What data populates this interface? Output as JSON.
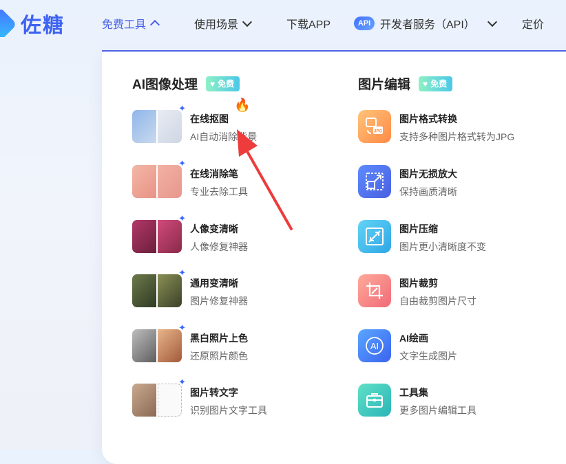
{
  "header": {
    "logo_text": "佐糖",
    "nav": [
      {
        "label": "免费工具",
        "state": "expanded"
      },
      {
        "label": "使用场景",
        "state": "collapsed"
      },
      {
        "label": "下载APP"
      },
      {
        "label": "开发者服务（API）",
        "badge": "API",
        "state": "collapsed"
      },
      {
        "label": "定价"
      }
    ],
    "accent_color": "#4a62e3"
  },
  "dropdown": {
    "sections": [
      {
        "title": "AI图像处理",
        "badge": "免费",
        "items": [
          {
            "title": "在线抠图",
            "desc": "AI自动消除背景",
            "hot_icon": "fire-icon"
          },
          {
            "title": "在线消除笔",
            "desc": "专业去除工具"
          },
          {
            "title": "人像变清晰",
            "desc": "人像修复神器"
          },
          {
            "title": "通用变清晰",
            "desc": "图片修复神器"
          },
          {
            "title": "黑白照片上色",
            "desc": "还原照片颜色"
          },
          {
            "title": "图片转文字",
            "desc": "识别图片文字工具"
          }
        ]
      },
      {
        "title": "图片编辑",
        "badge": "免费",
        "items": [
          {
            "title": "图片格式转换",
            "desc": "支持多种图片格式转为JPG",
            "icon": "format-convert-icon",
            "icon_label": "JPG"
          },
          {
            "title": "图片无损放大",
            "desc": "保持画质清晰",
            "icon": "upscale-icon"
          },
          {
            "title": "图片压缩",
            "desc": "图片更小清晰度不变",
            "icon": "compress-icon"
          },
          {
            "title": "图片裁剪",
            "desc": "自由裁剪图片尺寸",
            "icon": "crop-icon"
          },
          {
            "title": "AI绘画",
            "desc": "文字生成图片",
            "icon": "ai-paint-icon",
            "icon_label": "AI"
          },
          {
            "title": "工具集",
            "desc": "更多图片编辑工具",
            "icon": "toolbox-icon"
          }
        ]
      }
    ]
  },
  "annotation": {
    "type": "red-arrow",
    "points_to": "在线抠图",
    "color": "#ee3b3b"
  }
}
